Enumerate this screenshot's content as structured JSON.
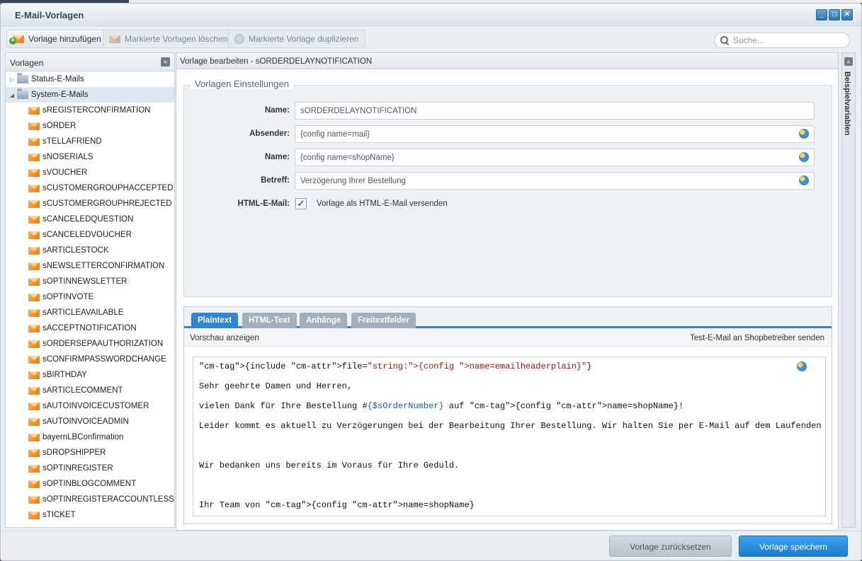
{
  "window": {
    "title": "E-Mail-Vorlagen",
    "buttons": [
      "_",
      "□",
      "✕"
    ]
  },
  "toolbar": {
    "add_label": "Vorlage hinzufügen",
    "delete_label": "Markierte Vorlagen löschen",
    "duplicate_label": "Markierte Vorlage duplizieren",
    "search_placeholder": "Suche..."
  },
  "sidebar": {
    "title": "Vorlagen",
    "folders": [
      {
        "label": "Status-E-Mails",
        "expanded": false
      },
      {
        "label": "System-E-Mails",
        "expanded": true
      }
    ],
    "items": [
      "sREGISTERCONFIRMATION",
      "sORDER",
      "sTELLAFRIEND",
      "sNOSERIALS",
      "sVOUCHER",
      "sCUSTOMERGROUPHACCEPTED",
      "sCUSTOMERGROUPHREJECTED",
      "sCANCELEDQUESTION",
      "sCANCELEDVOUCHER",
      "sARTICLESTOCK",
      "sNEWSLETTERCONFIRMATION",
      "sOPTINNEWSLETTER",
      "sOPTINVOTE",
      "sARTICLEAVAILABLE",
      "sACCEPTNOTIFICATION",
      "sORDERSEPAAUTHORIZATION",
      "sCONFIRMPASSWORDCHANGE",
      "sBIRTHDAY",
      "sARTICLECOMMENT",
      "sAUTOINVOICECUSTOMER",
      "sAUTOINVOICEADMIN",
      "bayernLBConfirmation",
      "sDROPSHIPPER",
      "sOPTINREGISTER",
      "sOPTINBLOGCOMMENT",
      "sOPTINREGISTERACCOUNTLESS",
      "sTICKET"
    ]
  },
  "editor": {
    "header": "Vorlage bearbeiten - sORDERDELAYNOTIFICATION",
    "settings_title": "Vorlagen Einstellungen",
    "fields": {
      "name": {
        "label": "Name:",
        "value": "sORDERDELAYNOTIFICATION"
      },
      "sender": {
        "label": "Absender:",
        "value": "{config name=mail}"
      },
      "sender_name": {
        "label": "Name:",
        "value": "{config name=shopName}"
      },
      "subject": {
        "label": "Betreff:",
        "value": "Verzögerung Ihrer Bestellung"
      },
      "html": {
        "label": "HTML-E-Mail:",
        "checkbox_label": "Vorlage als HTML-E-Mail versenden",
        "checked": true
      }
    },
    "tabs": [
      "Plaintext",
      "HTML-Text",
      "Anhänge",
      "Freitextfelder"
    ],
    "active_tab": "Plaintext",
    "preview_label": "Vorschau anzeigen",
    "test_mail_label": "Test-E-Mail an Shopbetreiber senden",
    "code_lines": [
      "{include file=\"string:{config name=emailheaderplain}\"}",
      "Sehr geehrte Damen und Herren,",
      "vielen Dank für Ihre Bestellung #{$sOrderNumber} auf {config name=shopName}!",
      "Leider kommt es aktuell zu Verzögerungen bei der Bearbeitung Ihrer Bestellung. Wir halten Sie per E-Mail auf dem Laufenden",
      "",
      "Wir bedanken uns bereits im Voraus für Ihre Geduld.",
      "",
      "Ihr Team von {config name=shopName}"
    ]
  },
  "right_panel": {
    "label": "Beispielvariablen"
  },
  "footer": {
    "reset_label": "Vorlage zurücksetzen",
    "save_label": "Vorlage speichern"
  },
  "colors": {
    "accent": "#2f86d3",
    "save_button": "#1b7bd0"
  }
}
